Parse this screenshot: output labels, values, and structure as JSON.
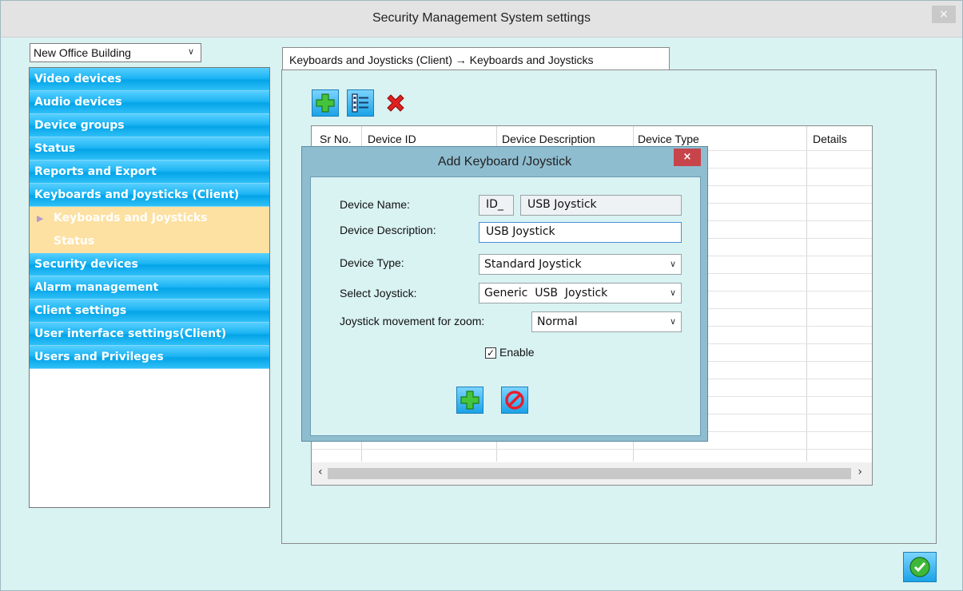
{
  "window": {
    "title": "Security Management System settings",
    "close_glyph": "×"
  },
  "building": {
    "selected": "New Office Building"
  },
  "nav": {
    "items": [
      {
        "label": "Video devices"
      },
      {
        "label": "Audio devices"
      },
      {
        "label": "Device groups"
      },
      {
        "label": "Status"
      },
      {
        "label": "Reports and Export"
      },
      {
        "label": "Keyboards and Joysticks (Client)"
      }
    ],
    "sub_items": [
      {
        "label": "Keyboards and Joysticks",
        "selected": true
      },
      {
        "label": "Status",
        "selected": false
      }
    ],
    "items_after": [
      {
        "label": "Security devices"
      },
      {
        "label": "Alarm management"
      },
      {
        "label": "Client settings"
      },
      {
        "label": "User interface settings(Client)"
      },
      {
        "label": "Users and Privileges"
      }
    ]
  },
  "tab": {
    "label": "Keyboards and Joysticks (Client) → Keyboards and Joysticks"
  },
  "toolbar": {
    "add_icon": "add-icon",
    "details_icon": "list-icon",
    "delete_icon": "delete-icon"
  },
  "grid": {
    "columns": [
      "Sr No.",
      "Device ID",
      "Device Description",
      "Device Type",
      "Details"
    ]
  },
  "dialog": {
    "title": "Add Keyboard /Joystick",
    "close_glyph": "×",
    "device_name_label": "Device Name:",
    "device_name_prefix": "ID_",
    "device_name_value": "USB Joystick",
    "device_description_label": "Device Description:",
    "device_description_value": "USB Joystick",
    "device_type_label": "Device Type:",
    "device_type_value": "Standard Joystick",
    "select_joystick_label": "Select Joystick:",
    "select_joystick_value": "Generic  USB  Joystick",
    "zoom_label": "Joystick movement for zoom:",
    "zoom_value": "Normal",
    "enable_label": "Enable",
    "enable_checked": true
  },
  "colors": {
    "nav_blue": "#04a4e8",
    "nav_sub": "#fde1a2",
    "window_bg": "#d9f2f2",
    "close_red": "#c8444b"
  }
}
